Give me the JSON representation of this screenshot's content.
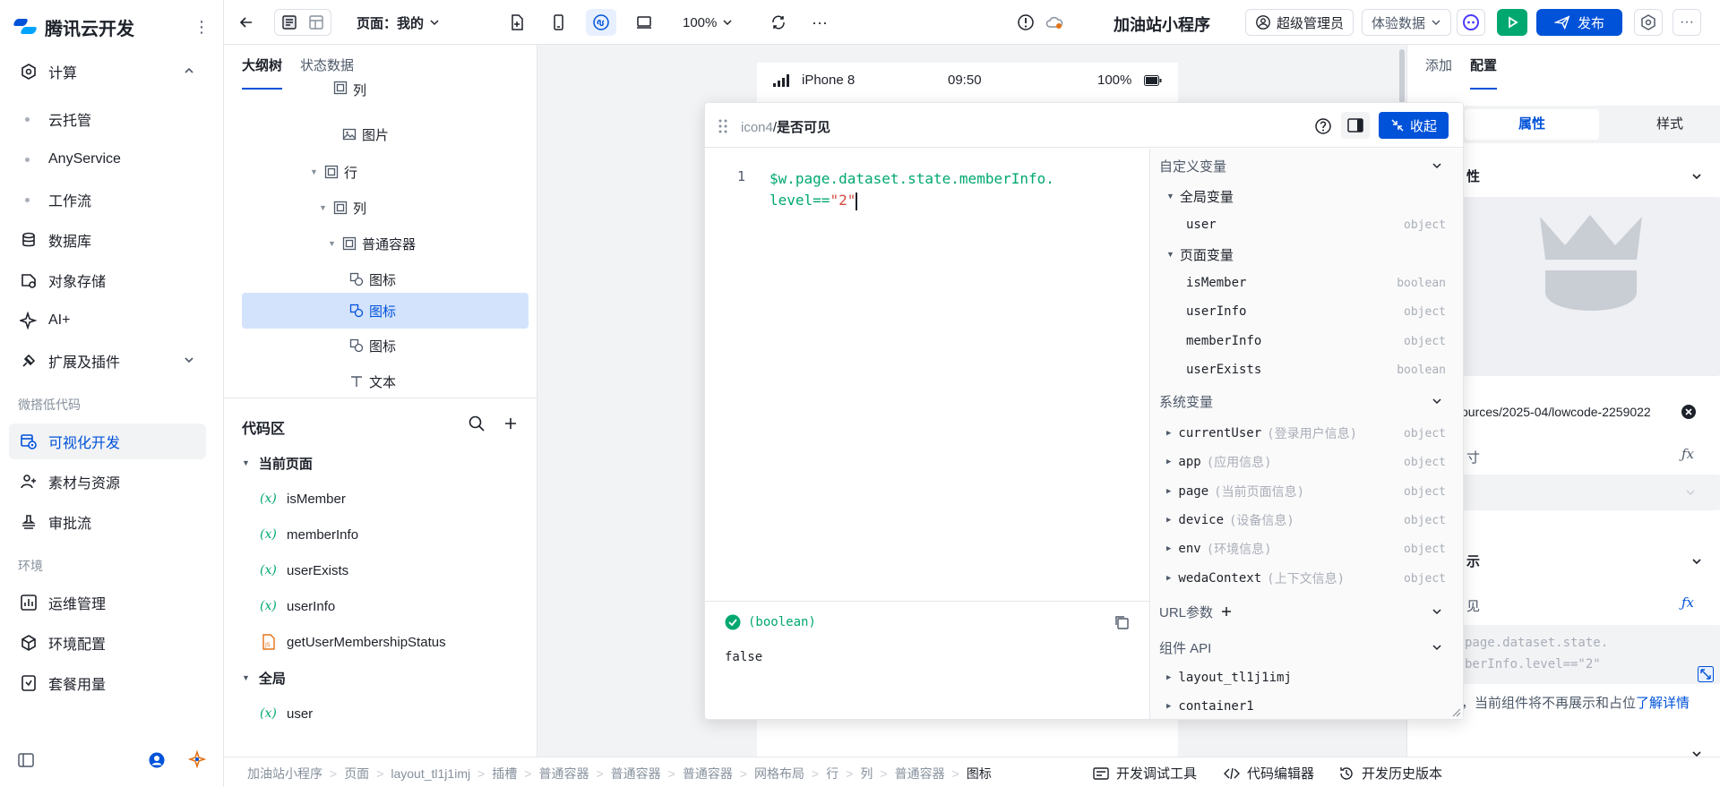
{
  "brand": {
    "name": "腾讯云开发"
  },
  "nav": {
    "compute": "计算",
    "compute_items": [
      "云托管",
      "AnyService",
      "工作流"
    ],
    "database": "数据库",
    "object_storage": "对象存储",
    "ai": "AI+",
    "extensions": "扩展及插件",
    "group_lowcode": "微搭低代码",
    "visual_dev": "可视化开发",
    "assets": "素材与资源",
    "approval": "审批流",
    "group_env": "环境",
    "ops": "运维管理",
    "env_config": "环境配置",
    "usage": "套餐用量"
  },
  "toolbar": {
    "page_label": "页面：我的",
    "zoom": "100%",
    "more": "···",
    "app_title": "加油站小程序",
    "role": "超级管理员",
    "data_mode": "体验数据",
    "publish": "发布"
  },
  "outline": {
    "tabs": [
      "大纲树",
      "状态数据"
    ],
    "rows": [
      {
        "label": "列"
      },
      {
        "label": "图片"
      },
      {
        "label": "行"
      },
      {
        "label": "列"
      },
      {
        "label": "普通容器"
      },
      {
        "label": "图标"
      },
      {
        "label": "图标"
      },
      {
        "label": "图标"
      },
      {
        "label": "文本"
      }
    ]
  },
  "code_panel": {
    "title": "代码区",
    "group_current": "当前页面",
    "current_items": [
      "isMember",
      "memberInfo",
      "userExists",
      "userInfo",
      "getUserMembershipStatus"
    ],
    "group_global": "全局",
    "global_items": [
      "user"
    ],
    "var_glyph": "(x)"
  },
  "phone": {
    "model": "iPhone 8",
    "time": "09:50",
    "battery": "100%"
  },
  "editor": {
    "path_component": "icon4",
    "path_sep": "/",
    "path_prop": "是否可见",
    "collapse": "收起",
    "line_no": "1",
    "code_line1": "$w.page.dataset.state.memberInfo.",
    "code_line2a": "level==",
    "code_line2b": "\"2\"",
    "result_type": "(boolean)",
    "result_value": "false"
  },
  "vars": {
    "custom": "自定义变量",
    "global": "全局变量",
    "global_items": [
      {
        "name": "user",
        "type": "object"
      }
    ],
    "page": "页面变量",
    "page_items": [
      {
        "name": "isMember",
        "type": "boolean"
      },
      {
        "name": "userInfo",
        "type": "object"
      },
      {
        "name": "memberInfo",
        "type": "object"
      },
      {
        "name": "userExists",
        "type": "boolean"
      }
    ],
    "system": "系统变量",
    "system_items": [
      {
        "name": "currentUser",
        "desc": "(登录用户信息)",
        "type": "object"
      },
      {
        "name": "app",
        "desc": "(应用信息)",
        "type": "object"
      },
      {
        "name": "page",
        "desc": "(当前页面信息)",
        "type": "object"
      },
      {
        "name": "device",
        "desc": "(设备信息)",
        "type": "object"
      },
      {
        "name": "env",
        "desc": "(环境信息)",
        "type": "object"
      },
      {
        "name": "wedaContext",
        "desc": "(上下文信息)",
        "type": "object"
      }
    ],
    "url_params": "URL参数",
    "component_api": "组件 API",
    "component_items": [
      "layout_tl1j1imj",
      "container1"
    ]
  },
  "config": {
    "tabs": [
      "添加",
      "配置"
    ],
    "seg": [
      "属性",
      "样式"
    ],
    "section_props": "性",
    "url_value": "ources/2025-04/lowcode-2259022",
    "size_label": "寸",
    "display_section": "示",
    "visible_label": "见",
    "expr_preview_1": "page.dataset.state.",
    "expr_preview_2": "berInfo.level==\"2\"",
    "hint": "，当前组件将不再展示和占位",
    "learn_more": "了解详情"
  },
  "bottom": {
    "crumbs": [
      "加油站小程序",
      "页面",
      "layout_tl1j1imj",
      "插槽",
      "普通容器",
      "普通容器",
      "普通容器",
      "网格布局",
      "行",
      "列",
      "普通容器",
      "图标"
    ],
    "debug": "开发调试工具",
    "code_editor": "代码编辑器",
    "history": "开发历史版本"
  },
  "colors": {
    "primary": "#0052d9",
    "success": "#00a870",
    "selected": "#d4e3fc"
  }
}
